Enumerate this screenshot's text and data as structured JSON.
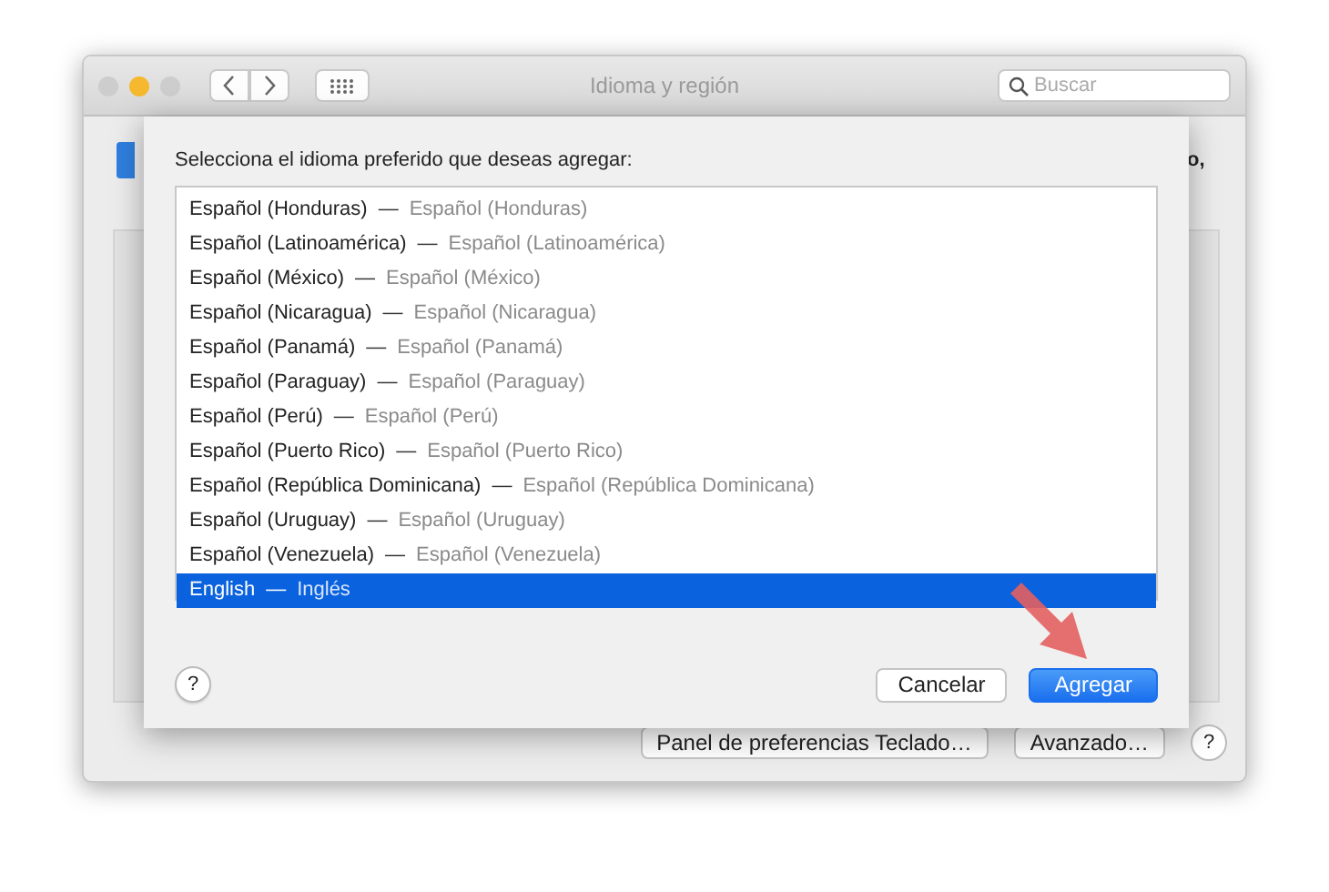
{
  "window": {
    "title": "Idioma y región",
    "traffic_lights": [
      {
        "color": "#cdcdcd"
      },
      {
        "color": "#f5b82e"
      },
      {
        "color": "#cdcdcd"
      }
    ],
    "search": {
      "placeholder": "Buscar"
    }
  },
  "main": {
    "partial_text": "o,",
    "buttons": [
      {
        "label": "Panel de preferencias Teclado…",
        "kind": "text"
      },
      {
        "label": "Avanzado…",
        "kind": "text"
      },
      {
        "label": "?",
        "kind": "help"
      }
    ]
  },
  "sheet": {
    "prompt": "Selecciona el idioma preferido que deseas agregar:",
    "languages": [
      {
        "name": "Español (Honduras)",
        "native": "Español (Honduras)",
        "selected": false
      },
      {
        "name": "Español (Latinoamérica)",
        "native": "Español (Latinoamérica)",
        "selected": false
      },
      {
        "name": "Español (México)",
        "native": "Español (México)",
        "selected": false
      },
      {
        "name": "Español (Nicaragua)",
        "native": "Español (Nicaragua)",
        "selected": false
      },
      {
        "name": "Español (Panamá)",
        "native": "Español (Panamá)",
        "selected": false
      },
      {
        "name": "Español (Paraguay)",
        "native": "Español (Paraguay)",
        "selected": false
      },
      {
        "name": "Español (Perú)",
        "native": "Español (Perú)",
        "selected": false
      },
      {
        "name": "Español (Puerto Rico)",
        "native": "Español (Puerto Rico)",
        "selected": false
      },
      {
        "name": "Español (República Dominicana)",
        "native": "Español (República Dominicana)",
        "selected": false
      },
      {
        "name": "Español (Uruguay)",
        "native": "Español (Uruguay)",
        "selected": false
      },
      {
        "name": "Español (Venezuela)",
        "native": "Español (Venezuela)",
        "selected": false
      },
      {
        "name": "English",
        "native": "Inglés",
        "selected": true
      }
    ],
    "separator": "—",
    "help": "?",
    "buttons": [
      {
        "label": "Cancelar",
        "kind": "normal"
      },
      {
        "label": "Agregar",
        "kind": "default"
      }
    ]
  }
}
